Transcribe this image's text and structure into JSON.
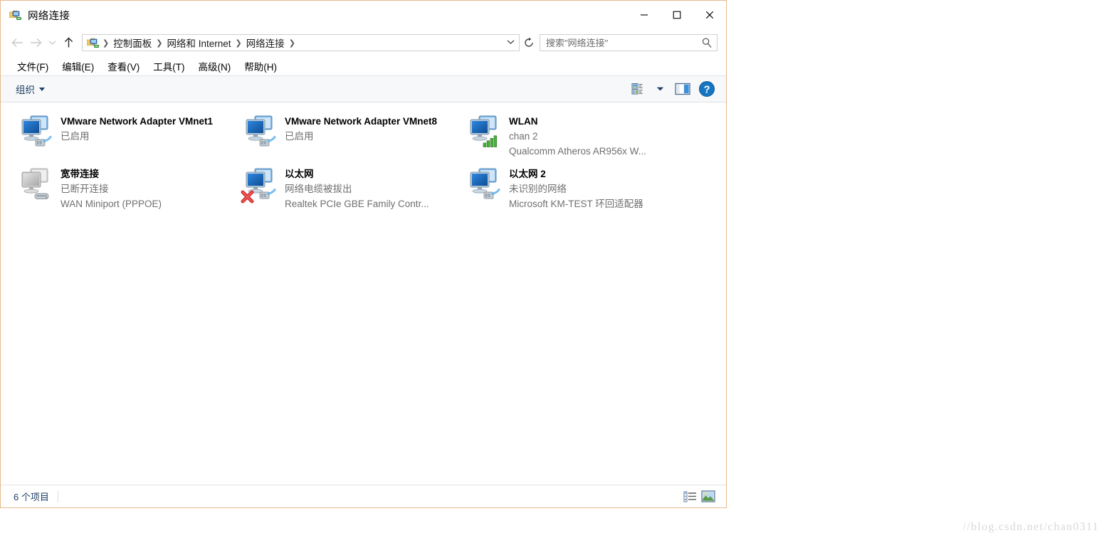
{
  "window": {
    "title": "网络连接",
    "icon": "network-connections-icon",
    "minimize_label": "最小化",
    "maximize_label": "最大化",
    "close_label": "关闭"
  },
  "addressbar": {
    "back_label": "后退",
    "forward_label": "前进",
    "recent_label": "最近浏览的位置",
    "up_label": "上移一级",
    "breadcrumbs": [
      "控制面板",
      "网络和 Internet",
      "网络连接"
    ],
    "refresh_label": "刷新",
    "search_placeholder": "搜索\"网络连接\"",
    "search_value": ""
  },
  "menubar": {
    "items": [
      "文件(F)",
      "编辑(E)",
      "查看(V)",
      "工具(T)",
      "高级(N)",
      "帮助(H)"
    ]
  },
  "commandbar": {
    "organize_label": "组织",
    "view_options_label": "更改您的视图",
    "preview_pane_label": "显示预览窗格",
    "help_label": "获取帮助"
  },
  "connections": [
    {
      "name": "VMware Network Adapter VMnet1",
      "status": "已启用",
      "device": "",
      "icon": "network-adapter-icon",
      "state": "enabled",
      "overlay": "cable"
    },
    {
      "name": "VMware Network Adapter VMnet8",
      "status": "已启用",
      "device": "",
      "icon": "network-adapter-icon",
      "state": "enabled",
      "overlay": "cable"
    },
    {
      "name": "WLAN",
      "status": "chan 2",
      "device": "Qualcomm Atheros AR956x W...",
      "icon": "wireless-adapter-icon",
      "state": "connected",
      "overlay": "signal-bars"
    },
    {
      "name": "宽带连接",
      "status": "已断开连接",
      "device": "WAN Miniport (PPPOE)",
      "icon": "broadband-connection-icon",
      "state": "disconnected",
      "overlay": "modem"
    },
    {
      "name": "以太网",
      "status": "网络电缆被拔出",
      "device": "Realtek PCIe GBE Family Contr...",
      "icon": "ethernet-adapter-icon",
      "state": "unplugged",
      "overlay": "cable-error"
    },
    {
      "name": "以太网 2",
      "status": "未识别的网络",
      "device": "Microsoft KM-TEST 环回适配器",
      "icon": "ethernet-adapter-icon",
      "state": "unidentified",
      "overlay": "cable"
    }
  ],
  "statusbar": {
    "item_count_text": "6 个项目",
    "large_icons_label": "详细信息",
    "tiles_view_label": "大图标"
  },
  "watermark": {
    "text": "//blog.csdn.net/chan0311"
  },
  "colors": {
    "window_border": "#e8b98c",
    "accent_blue": "#1f3f66",
    "help_blue": "#1675c0",
    "signal_green": "#3f9c35",
    "error_red": "#d12e2e"
  }
}
